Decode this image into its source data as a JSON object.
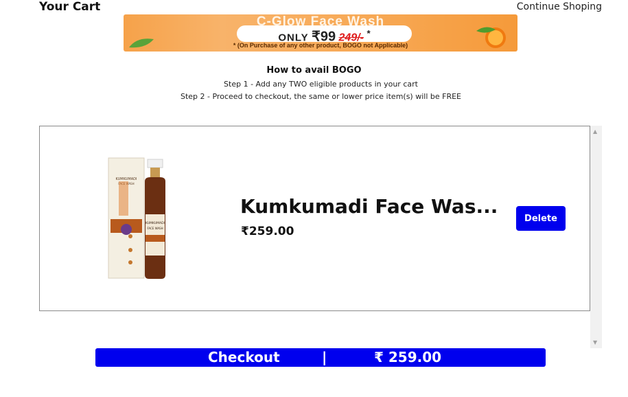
{
  "header": {
    "title": "Your Cart",
    "continue_label": "Continue Shoping"
  },
  "banner": {
    "headline": "C-Glow Face Wash",
    "only": "ONLY",
    "price": "₹99",
    "mrp": "249/-",
    "asterisk": "*",
    "note": "* (On Purchase of any other product, BOGO not Applicable)"
  },
  "bogo": {
    "heading": "How to avail BOGO",
    "step1": "Step 1 - Add any TWO eligible products in your cart",
    "step2": "Step 2 - Proceed to checkout, the same or lower price item(s) will be FREE"
  },
  "cart": {
    "items": [
      {
        "name": "Kumkumadi Face Was...",
        "price": "₹259.00",
        "delete_label": "Delete"
      }
    ]
  },
  "checkout": {
    "label": "Checkout",
    "separator": "|",
    "total": "₹ 259.00"
  },
  "colors": {
    "accent": "#0000ee",
    "banner_orange": "#f6a24a"
  }
}
